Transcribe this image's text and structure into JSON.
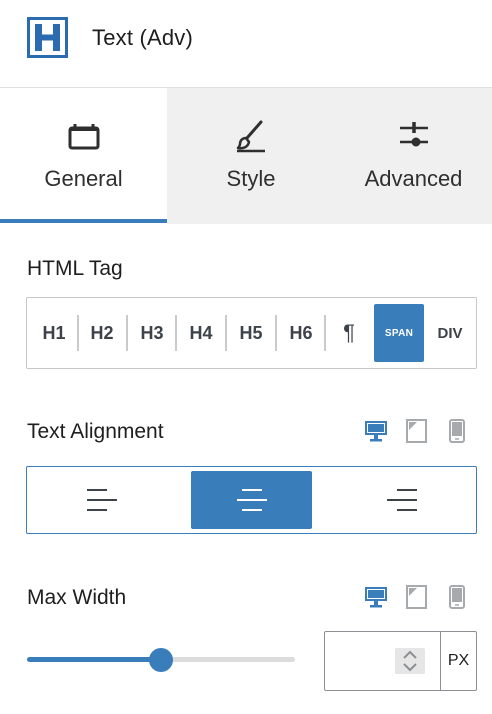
{
  "header": {
    "icon": "heading-h-block-icon",
    "title": "Text (Adv)"
  },
  "tabs": [
    {
      "label": "General",
      "icon": "panel-icon",
      "active": true
    },
    {
      "label": "Style",
      "icon": "brush-icon",
      "active": false
    },
    {
      "label": "Advanced",
      "icon": "sliders-icon",
      "active": false
    }
  ],
  "html_tag": {
    "label": "HTML Tag",
    "options": [
      "H1",
      "H2",
      "H3",
      "H4",
      "H5",
      "H6",
      "¶",
      "SPAN",
      "DIV"
    ],
    "selected": "SPAN"
  },
  "text_alignment": {
    "label": "Text Alignment",
    "devices": [
      "desktop-icon",
      "tablet-icon",
      "mobile-icon"
    ],
    "active_device": "desktop",
    "options": [
      "left",
      "center",
      "right"
    ],
    "selected": "center"
  },
  "max_width": {
    "label": "Max Width",
    "devices": [
      "desktop-icon",
      "tablet-icon",
      "mobile-icon"
    ],
    "active_device": "desktop",
    "slider_fraction": 0.5,
    "value": "",
    "unit": "PX"
  },
  "colors": {
    "accent": "#3a7dbb",
    "tab_inactive_bg": "#f0f0f0",
    "border": "#c5c7c9",
    "inactive_device_icon": "#a7aaad"
  }
}
